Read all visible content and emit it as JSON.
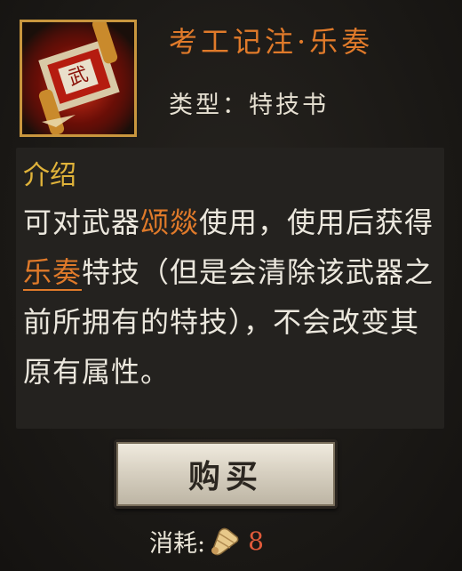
{
  "item": {
    "name": "考工记注·乐奏",
    "type_label": "类型：",
    "type_value": "特技书"
  },
  "description": {
    "heading": "介绍",
    "seg1": "可对武器",
    "seg2": "颂燚",
    "seg3": "使用，使用后获得",
    "seg4": "乐奏",
    "seg5": "特技（但是会清除该武器之前所拥有的特技），不会改变其原有属性。"
  },
  "buy_button": {
    "label": "购买"
  },
  "cost": {
    "label": "消耗:",
    "icon": "scroll-token-icon",
    "amount": "8"
  },
  "colors": {
    "accent": "#e07a2a",
    "heading": "#e0b33a",
    "frame": "#c9963e"
  }
}
